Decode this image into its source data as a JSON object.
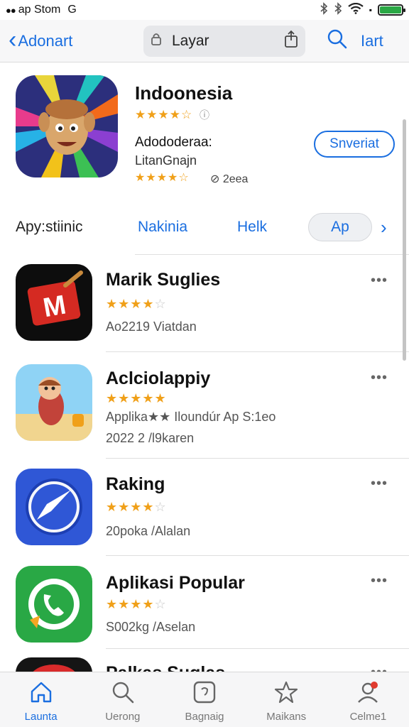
{
  "status_bar": {
    "carrier": "ap Stom",
    "signal_dots": "●●",
    "globe": "G"
  },
  "nav": {
    "back_label": "Adonart",
    "search_text": "Layar",
    "right_label": "Iart"
  },
  "featured": {
    "title": "Indoonesia",
    "rating_stars": "★★★★☆",
    "rating_info": "ⓘ",
    "subtitle": "Adododeraa:",
    "developer": "LitanGnajn",
    "rating_stars2": "★★★★☆",
    "count": "⊘ 2eea",
    "get_label": "Snveriat"
  },
  "tabs": {
    "label": "Apy:stiinic",
    "items": [
      "Nakinia",
      "Helk"
    ],
    "pill": "Ap",
    "next": "›"
  },
  "apps": [
    {
      "name": "Marik Suglies",
      "stars": "★★★★",
      "empty": "☆",
      "meta": "Ao2219 Viatdan",
      "meta2": ""
    },
    {
      "name": "Aclciolappiy",
      "stars": "★★★★★",
      "empty": "",
      "meta": "Applika★★ Iloundúr Ap S:1eo",
      "meta2": "2022 2 /l9karen"
    },
    {
      "name": "Raking",
      "stars": "★★★★",
      "empty": "☆",
      "meta": "20poka /Alalan",
      "meta2": ""
    },
    {
      "name": "Aplikasi Popular",
      "stars": "★★★★",
      "empty": "☆",
      "meta": "S002kg /Aselan",
      "meta2": ""
    },
    {
      "name": "Palkas Suglas",
      "stars": "",
      "empty": "",
      "meta": "",
      "meta2": ""
    }
  ],
  "more_label": "•••",
  "tabbar": [
    {
      "label": "Launta",
      "icon": "home-icon"
    },
    {
      "label": "Uerong",
      "icon": "search-icon"
    },
    {
      "label": "Bagnaig",
      "icon": "apps-icon"
    },
    {
      "label": "Maikans",
      "icon": "star-icon"
    },
    {
      "label": "Celme1",
      "icon": "profile-icon"
    }
  ],
  "colors": {
    "accent": "#1a6ee0",
    "star": "#f0a019",
    "battery": "#2aa845"
  }
}
